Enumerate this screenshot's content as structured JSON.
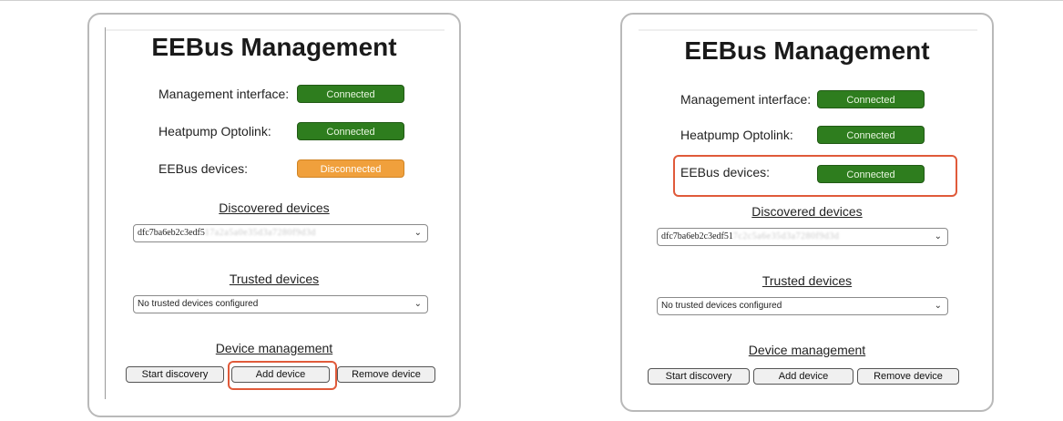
{
  "left": {
    "title": "EEBus Management",
    "rows": [
      {
        "label": "Management interface:",
        "status": "Connected"
      },
      {
        "label": "Heatpump Optolink:",
        "status": "Connected"
      },
      {
        "label": "EEBus devices:",
        "status": "Disconnected"
      }
    ],
    "discovered_title": "Discovered devices",
    "discovered_value": "dfc7ba6eb2c3edf5",
    "discovered_value_blur": "17a2a5a0e35d3a7280f9d3d",
    "trusted_title": "Trusted devices",
    "trusted_value": "No trusted devices configured",
    "mgmt_title": "Device management",
    "buttons": [
      "Start discovery",
      "Add device",
      "Remove device"
    ]
  },
  "right": {
    "title": "EEBus Management",
    "rows": [
      {
        "label": "Management interface:",
        "status": "Connected"
      },
      {
        "label": "Heatpump Optolink:",
        "status": "Connected"
      },
      {
        "label": "EEBus devices:",
        "status": "Connected"
      }
    ],
    "discovered_title": "Discovered devices",
    "discovered_value": "dfc7ba6eb2c3edf51",
    "discovered_value_blur": "7c2c5a6e35d3a7280f9d3d",
    "trusted_title": "Trusted devices",
    "trusted_value": "No trusted devices configured",
    "mgmt_title": "Device management",
    "buttons": [
      "Start discovery",
      "Add device",
      "Remove device"
    ]
  },
  "colors": {
    "connected": "#2e7d1e",
    "disconnected": "#f0a03c",
    "highlight": "#e05a3a"
  }
}
